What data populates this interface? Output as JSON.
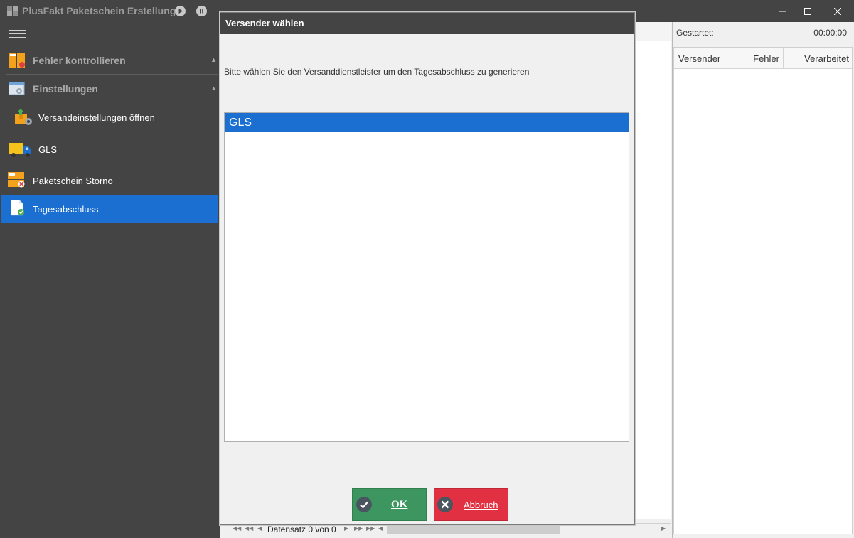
{
  "window": {
    "title": "PlusFakt Paketschein Erstellung",
    "controls": {
      "minimize": "minimize-icon",
      "maximize": "maximize-icon",
      "close": "close-icon"
    }
  },
  "toolbar": {
    "play_icon": "play-icon",
    "pause_icon": "pause-icon"
  },
  "sidebar": {
    "menu_icon": "hamburger-icon",
    "groups": [
      {
        "label": "Fehler kontrollieren",
        "icon": "error-check-icon",
        "expanded": true
      },
      {
        "label": "Einstellungen",
        "icon": "settings-icon",
        "expanded": true
      }
    ],
    "items": [
      {
        "label": "Versandeinstellungen öffnen",
        "icon": "shipping-settings-icon",
        "active": false
      },
      {
        "label": "GLS",
        "icon": "truck-icon",
        "active": false
      },
      {
        "label": "Paketschein Storno",
        "icon": "cancel-parcel-icon",
        "active": false
      },
      {
        "label": "Tagesabschluss",
        "icon": "daily-close-icon",
        "active": true
      }
    ]
  },
  "navigator": {
    "text": "Datensatz 0 von 0"
  },
  "right_panel": {
    "started_label": "Gestartet:",
    "started_value": "00:00:00",
    "columns": [
      "Versender",
      "Fehler",
      "Verarbeitet"
    ]
  },
  "dialog": {
    "title": "Versender wählen",
    "prompt": "Bitte wählen Sie den Versanddienstleister um den Tagesabschluss zu generieren",
    "options": [
      "GLS"
    ],
    "selected": "GLS",
    "ok_label": "OK",
    "cancel_label": "Abbruch"
  },
  "colors": {
    "chrome": "#444444",
    "accent": "#1a6fd1",
    "ok": "#3d9560",
    "cancel": "#e03041"
  }
}
